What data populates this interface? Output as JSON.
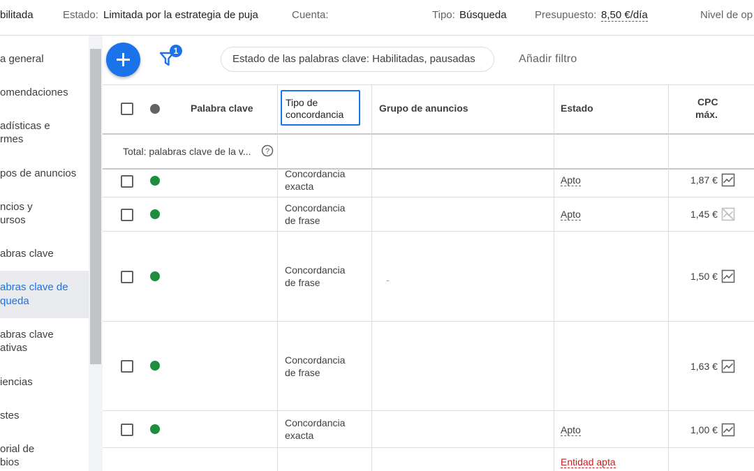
{
  "topbar": {
    "status_value": "bilitada",
    "estado_label": "Estado:",
    "estado_value": "Limitada por la estrategia de puja",
    "cuenta_label": "Cuenta:",
    "tipo_label": "Tipo:",
    "tipo_value": "Búsqueda",
    "presupuesto_label": "Presupuesto:",
    "presupuesto_value": "8,50 €/día",
    "nivel_label": "Nivel de op"
  },
  "sidebar": {
    "items": [
      {
        "label": "a general"
      },
      {
        "label": "omendaciones"
      },
      {
        "label": "adísticas e",
        "label2": "rmes"
      },
      {
        "label": "pos de anuncios"
      },
      {
        "label": "ncios y",
        "label2": "ursos"
      },
      {
        "label": "abras clave"
      },
      {
        "label": "abras clave de",
        "label2": "queda"
      },
      {
        "label": "abras clave",
        "label2": "ativas"
      },
      {
        "label": "iencias"
      },
      {
        "label": "stes"
      },
      {
        "label": "orial de",
        "label2": "bios"
      }
    ]
  },
  "toolbar": {
    "filter_count": "1",
    "chip_label": "Estado de las palabras clave: Habilitadas, pausadas",
    "add_filter_label": "Añadir filtro"
  },
  "table": {
    "headers": {
      "keyword": "Palabra clave",
      "match_type_1": "Tipo de",
      "match_type_2": "concordancia",
      "ad_group": "Grupo de anuncios",
      "status": "Estado",
      "cpc_1": "CPC",
      "cpc_2": "máx."
    },
    "total_label": "Total: palabras clave de la v...",
    "rows": [
      {
        "match_1": "Concordancia",
        "match_2": "exacta",
        "status": "Apto",
        "cpc": "1,87 €",
        "chart_icon": "trend-chart-icon"
      },
      {
        "match_1": "Concordancia",
        "match_2": "de frase",
        "status": "Apto",
        "cpc": "1,45 €",
        "chart_icon": "trend-chart-disabled-icon"
      },
      {
        "match_1": "Concordancia",
        "match_2": "de frase",
        "status": "",
        "cpc": "1,50 €",
        "ad_group": "-",
        "chart_icon": "trend-chart-icon"
      },
      {
        "match_1": "Concordancia",
        "match_2": "de frase",
        "status": "",
        "cpc": "1,63 €",
        "chart_icon": "trend-chart-icon"
      },
      {
        "match_1": "Concordancia",
        "match_2": "exacta",
        "status": "Apto",
        "cpc": "1,00 €",
        "chart_icon": "trend-chart-icon"
      },
      {
        "status": "Entidad apta"
      }
    ]
  },
  "colors": {
    "accent": "#1a73e8",
    "enabled_dot": "#1e8e3e",
    "header_dot": "#5f6368",
    "warning_text": "#c5221f"
  }
}
